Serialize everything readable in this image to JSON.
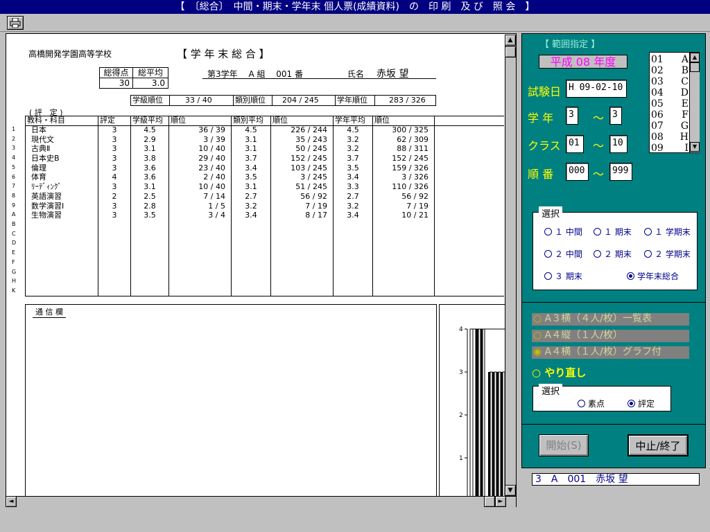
{
  "window_title": "【　〔総合〕　中間・期末・学年末 個人票(成績資料)　の　印 刷　及 び　照 会　】",
  "report": {
    "school": "高橋開発学園高等学校",
    "title": "【 学 年 末 総 合 】",
    "total_label": "総得点",
    "total_value": "30",
    "avg_label": "総平均",
    "avg_value": "3.0",
    "student_line": "第3学年　 A 組　 001 番",
    "name_label": "氏名",
    "name_value": "赤坂 望",
    "class_rank_label": "学級順位",
    "class_rank_value": "33 /  40",
    "type_rank_label": "類別順位",
    "type_rank_value": "204 / 245",
    "grade_rank_label": "学年順位",
    "grade_rank_value": "283 / 326",
    "eval_header": "( 評　定 )",
    "columns": [
      "教科・科目",
      "評定",
      "学級平均",
      "順位",
      "類別平均",
      "順位",
      "学年平均",
      "順位"
    ],
    "rows": [
      {
        "idx": "1",
        "subject": "日本",
        "grade": "3",
        "cavg": "4.5",
        "crank": "36 /  39",
        "tavg": "4.5",
        "trank": "226 / 244",
        "gavg": "4.5",
        "grank": "300 / 325"
      },
      {
        "idx": "2",
        "subject": "現代文",
        "grade": "3",
        "cavg": "2.9",
        "crank": "3 /  39",
        "tavg": "3.1",
        "trank": "35 / 243",
        "gavg": "3.2",
        "grank": "62 / 309"
      },
      {
        "idx": "3",
        "subject": "古典Ⅱ",
        "grade": "3",
        "cavg": "3.1",
        "crank": "10 /  40",
        "tavg": "3.1",
        "trank": "50 / 245",
        "gavg": "3.2",
        "grank": "88 / 311"
      },
      {
        "idx": "4",
        "subject": "日本史B",
        "grade": "3",
        "cavg": "3.8",
        "crank": "29 /  40",
        "tavg": "3.7",
        "trank": "152 / 245",
        "gavg": "3.7",
        "grank": "152 / 245"
      },
      {
        "idx": "5",
        "subject": "倫理",
        "grade": "3",
        "cavg": "3.6",
        "crank": "23 /  40",
        "tavg": "3.4",
        "trank": "103 / 245",
        "gavg": "3.5",
        "grank": "159 / 326"
      },
      {
        "idx": "6",
        "subject": "体育",
        "grade": "4",
        "cavg": "3.6",
        "crank": "2 /  40",
        "tavg": "3.5",
        "trank": "3 / 245",
        "gavg": "3.4",
        "grank": "3 / 326"
      },
      {
        "idx": "7",
        "subject": "ﾘｰﾃﾞｨﾝｸﾞ",
        "grade": "3",
        "cavg": "3.1",
        "crank": "10 /  40",
        "tavg": "3.1",
        "trank": "51 / 245",
        "gavg": "3.3",
        "grank": "110 / 326"
      },
      {
        "idx": "8",
        "subject": "英語演習",
        "grade": "2",
        "cavg": "2.5",
        "crank": "7 /  14",
        "tavg": "2.7",
        "trank": "56 /  92",
        "gavg": "2.7",
        "grank": "56 /  92"
      },
      {
        "idx": "9",
        "subject": "数学演習Ⅰ",
        "grade": "3",
        "cavg": "2.8",
        "crank": "1 /   5",
        "tavg": "3.2",
        "trank": "7 /  19",
        "gavg": "3.2",
        "grank": "7 /  19"
      },
      {
        "idx": "A",
        "subject": "生物演習",
        "grade": "3",
        "cavg": "3.5",
        "crank": "3 /   4",
        "tavg": "3.4",
        "trank": "8 /  17",
        "gavg": "3.4",
        "grank": "10 /  21"
      }
    ],
    "empty_idx": [
      "B",
      "C",
      "D",
      "E",
      "F",
      "G",
      "H",
      "K"
    ],
    "comm_label": "通 信 欄",
    "chart_ticks": [
      "4",
      "3",
      "2",
      "1"
    ]
  },
  "panel": {
    "range_title": "【 範囲指定 】",
    "year": "平成 08 年度",
    "list_items": [
      {
        "n": "01",
        "c": "A"
      },
      {
        "n": "02",
        "c": "B"
      },
      {
        "n": "03",
        "c": "C"
      },
      {
        "n": "04",
        "c": "D"
      },
      {
        "n": "05",
        "c": "E"
      },
      {
        "n": "06",
        "c": "F"
      },
      {
        "n": "07",
        "c": "G"
      },
      {
        "n": "08",
        "c": "H"
      },
      {
        "n": "09",
        "c": "I"
      }
    ],
    "exam_date_label": "試験日",
    "exam_date": "H 09-02-10",
    "grade_label": "学 年",
    "grade_from": "3",
    "grade_to": "3",
    "class_label": "クラス",
    "class_from": "01",
    "class_to": "10",
    "seq_label": "順 番",
    "seq_from": "000",
    "seq_to": "999",
    "tilde": "～",
    "select_title": "選択",
    "select_options": [
      "１ 中間",
      "１ 期末",
      "１ 学期末",
      "２ 中間",
      "２ 期末",
      "２ 学期末",
      "３ 期末",
      "学年末総合"
    ],
    "print_options": [
      "A３横（４人/枚）一覧表",
      "A４縦（１人/枚）",
      "A４横（１人/枚）グラフ付"
    ],
    "redo_label": "やり直し",
    "select2_title": "選択",
    "select2_options": [
      "素点",
      "評定"
    ],
    "start_label": "開始(S)",
    "stop_label": "中止/終了"
  },
  "status": "3　A　001　赤坂 望"
}
